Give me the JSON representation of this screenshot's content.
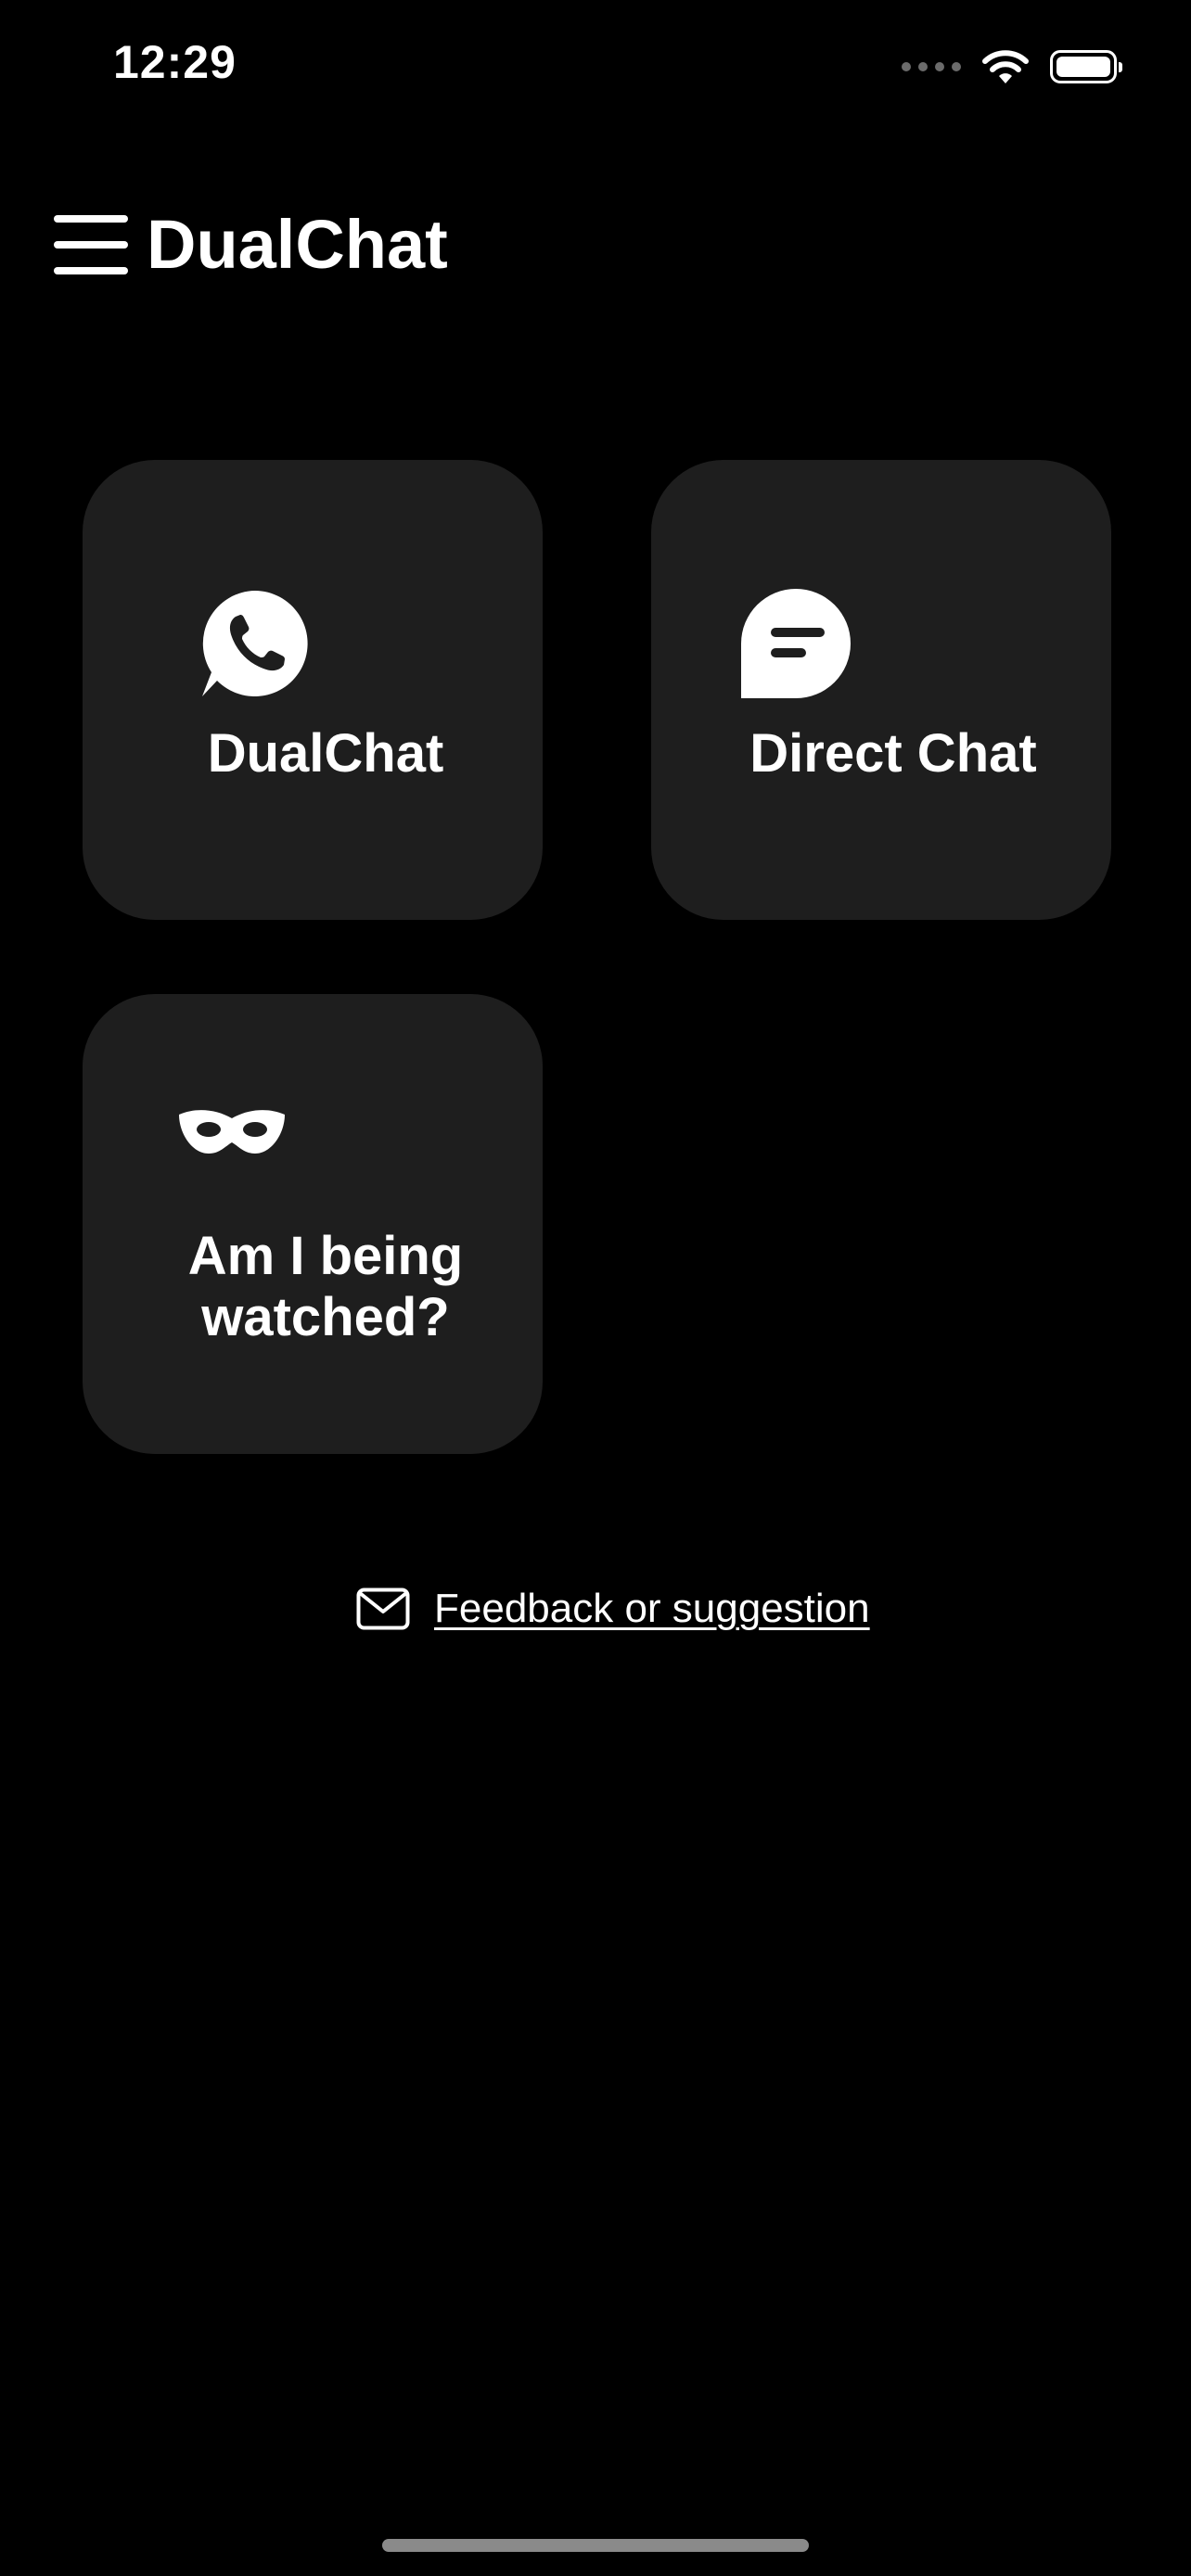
{
  "status_bar": {
    "time": "12:29"
  },
  "header": {
    "title": "DualChat",
    "menu_icon": "hamburger-menu-icon"
  },
  "tiles": [
    {
      "label": "DualChat",
      "icon": "whatsapp-phone-icon"
    },
    {
      "label": "Direct Chat",
      "icon": "chat-bubble-icon"
    },
    {
      "label": "Am I being\nwatched?",
      "icon": "mask-icon"
    }
  ],
  "feedback": {
    "label": "Feedback or suggestion",
    "icon": "envelope-icon"
  },
  "colors": {
    "background": "#000000",
    "tile": "#1e1e1e",
    "text": "#ffffff"
  }
}
